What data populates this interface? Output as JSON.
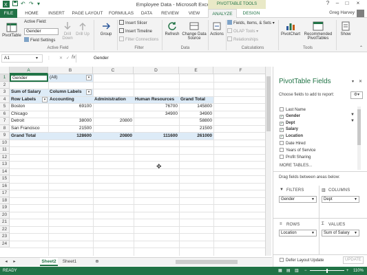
{
  "window": {
    "title": "Employee Data - Microsoft Excel Preview",
    "context_tools_label": "PIVOTTABLE TOOLS",
    "user_name": "Greg Harvey",
    "win_help": "?",
    "win_min": "–",
    "win_max": "□",
    "win_close": "×"
  },
  "tabs": [
    "FILE",
    "HOME",
    "INSERT",
    "PAGE LAYOUT",
    "FORMULAS",
    "DATA",
    "REVIEW",
    "VIEW",
    "ANALYZE",
    "DESIGN"
  ],
  "ribbon": {
    "pivottable_label": "PivotTable",
    "active_field_label": "Active Field:",
    "active_field_value": "Gender",
    "field_settings": "Field Settings",
    "drill_down": "Drill Down",
    "drill_up": "Drill Up",
    "group": "Group",
    "insert_slicer": "Insert Slicer",
    "insert_timeline": "Insert Timeline",
    "filter_connections": "Filter Connections",
    "refresh": "Refresh",
    "change_data_source": "Change Data Source",
    "actions": "Actions",
    "fields_items_sets": "Fields, Items, & Sets",
    "olap_tools": "OLAP Tools",
    "relationships": "Relationships",
    "pivotchart": "PivotChart",
    "recommended_pivottables": "Recommended PivotTables",
    "show": "Show",
    "group_labels": {
      "active_field": "Active Field",
      "filter": "Filter",
      "data": "Data",
      "calculations": "Calculations",
      "tools": "Tools"
    }
  },
  "formula_bar": {
    "name_box": "A1",
    "fx": "fx",
    "value": "Gender"
  },
  "grid": {
    "columns": [
      "A",
      "B",
      "C",
      "D",
      "E",
      "F"
    ],
    "rows": [
      "1",
      "2",
      "3",
      "4",
      "5",
      "6",
      "7",
      "8",
      "9",
      "10",
      "11",
      "12",
      "13",
      "14",
      "15",
      "16",
      "17",
      "18",
      "19",
      "20",
      "21",
      "22",
      "23",
      "24"
    ],
    "a1": "Gender",
    "b1": "(All)",
    "a3": "Sum of Salary",
    "b3": "Column Labels",
    "row_labels": "Row Labels",
    "col_headers": [
      "Accounting",
      "Administration",
      "Human Resources",
      "Grand Total"
    ],
    "data_rows": [
      {
        "label": "Boston",
        "values": [
          "69100",
          "",
          "76700",
          "145800"
        ]
      },
      {
        "label": "Chicago",
        "values": [
          "",
          "",
          "34900",
          "34900"
        ]
      },
      {
        "label": "Detroit",
        "values": [
          "38000",
          "20800",
          "",
          "58800"
        ]
      },
      {
        "label": "San Francisco",
        "values": [
          "21500",
          "",
          "",
          "21500"
        ]
      }
    ],
    "grand_total": {
      "label": "Grand Total",
      "values": [
        "128600",
        "20800",
        "111600",
        "261000"
      ]
    }
  },
  "sheets": [
    "Sheet2",
    "Sheet1"
  ],
  "status": {
    "left": "READY",
    "zoom": "110%"
  },
  "pane": {
    "title": "PivotTable Fields",
    "choose": "Choose fields to add to report:",
    "fields": [
      {
        "name": "Last Name",
        "checked": false
      },
      {
        "name": "Gender",
        "checked": true
      },
      {
        "name": "Dept",
        "checked": true
      },
      {
        "name": "Salary",
        "checked": true
      },
      {
        "name": "Location",
        "checked": true
      },
      {
        "name": "Date Hired",
        "checked": false
      },
      {
        "name": "Years of Service",
        "checked": false
      },
      {
        "name": "Profit Sharing",
        "checked": false
      }
    ],
    "more_tables": "MORE TABLES...",
    "drag_label": "Drag fields between areas below:",
    "filters_label": "FILTERS",
    "columns_label": "COLUMNS",
    "rows_label": "ROWS",
    "values_label": "VALUES",
    "filters_value": "Gender",
    "columns_value": "Dept",
    "rows_value": "Location",
    "values_value": "Sum of Salary",
    "defer_label": "Defer Layout Update",
    "update": "UPDATE"
  },
  "colors": {
    "excel_green": "#217346",
    "pivot_header_blue": "#ddebf7"
  }
}
